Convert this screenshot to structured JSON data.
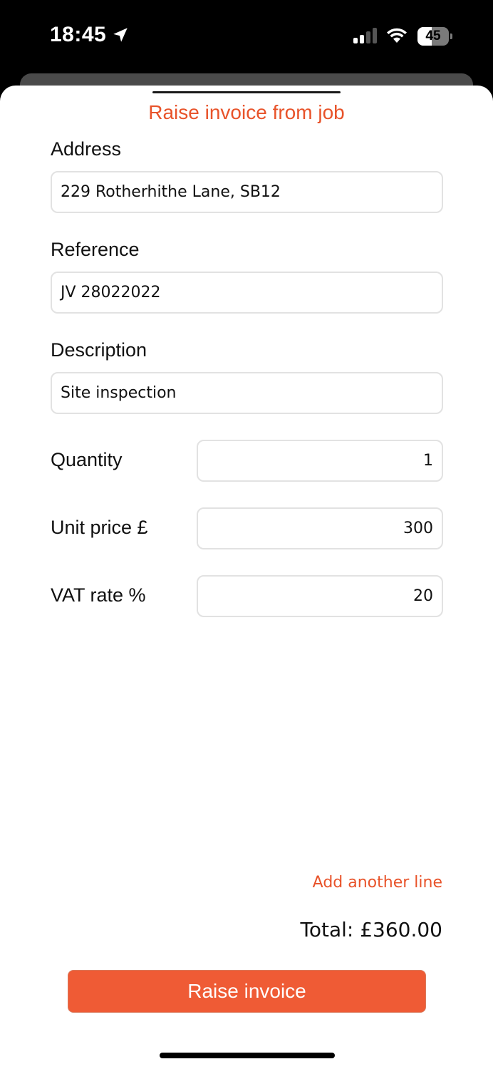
{
  "status_bar": {
    "time": "18:45",
    "location_icon": "location-arrow-icon",
    "signal_icon": "cellular-signal-icon",
    "signal_bars_active": 2,
    "signal_bars_total": 4,
    "wifi_icon": "wifi-icon",
    "battery_icon": "battery-icon",
    "battery_level": "45",
    "battery_fraction": 0.45
  },
  "sheet": {
    "title": "Raise invoice from job"
  },
  "form": {
    "address": {
      "label": "Address",
      "value": "229 Rotherhithe Lane, SB12"
    },
    "reference": {
      "label": "Reference",
      "value": "JV 28022022"
    },
    "description": {
      "label": "Description",
      "value": "Site inspection"
    },
    "quantity": {
      "label": "Quantity",
      "value": "1"
    },
    "unit_price": {
      "label": "Unit price £",
      "value": "300"
    },
    "vat_rate": {
      "label": "VAT rate %",
      "value": "20"
    }
  },
  "footer": {
    "add_line_label": "Add another line",
    "total_text": "Total: £360.00",
    "raise_button_label": "Raise invoice"
  },
  "colors": {
    "accent": "#e8532a",
    "button": "#ef5b35"
  }
}
